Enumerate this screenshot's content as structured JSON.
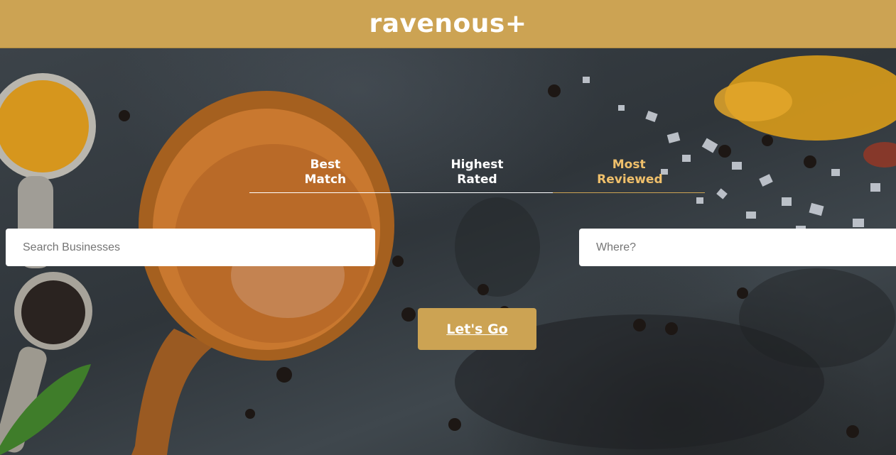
{
  "header": {
    "logo": "ravenous+",
    "background_color": "#cca353"
  },
  "sort_options": [
    {
      "label": "Best Match",
      "active": false
    },
    {
      "label": "Highest Rated",
      "active": false
    },
    {
      "label": "Most Reviewed",
      "active": true
    }
  ],
  "search": {
    "business_placeholder": "Search Businesses",
    "business_value": "",
    "location_placeholder": "Where?",
    "location_value": ""
  },
  "submit": {
    "label": "Let's Go"
  },
  "colors": {
    "accent": "#cca353",
    "active_tab_text": "#f0c06b",
    "tab_text": "#ffffff"
  }
}
